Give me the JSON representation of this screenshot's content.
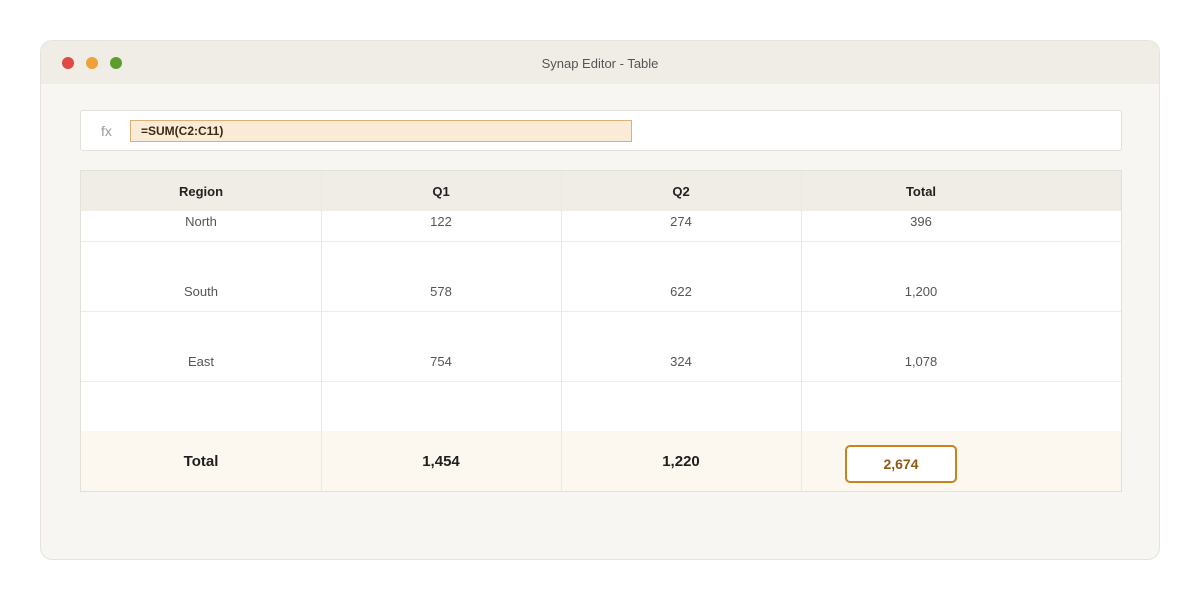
{
  "window": {
    "title": "Synap Editor - Table"
  },
  "formula_bar": {
    "label": "fx",
    "value": "=SUM(C2:C11)"
  },
  "table": {
    "columns": [
      "Region",
      "Q1",
      "Q2",
      "Total"
    ],
    "rows": [
      [
        "North",
        "122",
        "274",
        "396"
      ],
      [
        "South",
        "578",
        "622",
        "1,200"
      ],
      [
        "East",
        "754",
        "324",
        "1,078"
      ]
    ],
    "total_row": [
      "Total",
      "1,454",
      "1,220",
      "2,674"
    ]
  },
  "colors": {
    "accent": "#c8831e",
    "formula_highlight": "#faebd7",
    "total_row_bg": "#fdf8ef",
    "header_bg": "#f0ede6"
  }
}
